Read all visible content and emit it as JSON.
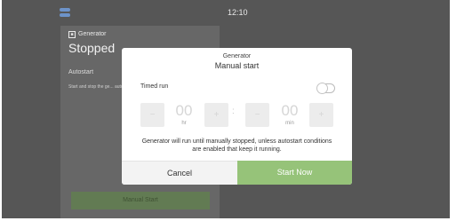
{
  "statusbar": {
    "time": "12:10",
    "icon": "status-bars-icon"
  },
  "card": {
    "icon": "generator-icon",
    "small_title": "Generator",
    "status": "Stopped",
    "autostart_label": "Autostart",
    "autostart_desc": "Start and stop the ge... autostart conditions",
    "button_label": "Manual Start"
  },
  "dialog": {
    "subtitle": "Generator",
    "title": "Manual start",
    "timed_run_label": "Timed run",
    "timed_run_enabled": false,
    "timer": {
      "hours": "00",
      "hours_unit": "hr",
      "minutes": "00",
      "minutes_unit": "min",
      "separator": ":",
      "decrement_symbol": "−",
      "increment_symbol": "+"
    },
    "message": "Generator will run until manually stopped, unless autostart conditions are enabled that keep it running.",
    "cancel_label": "Cancel",
    "confirm_label": "Start Now"
  },
  "colors": {
    "accent": "#96c379",
    "overlay": "#565656",
    "status_icon": "#6d93c9"
  }
}
